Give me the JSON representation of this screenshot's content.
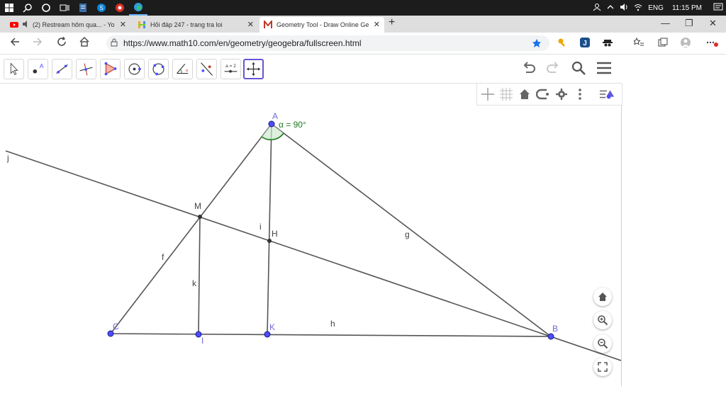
{
  "taskbar": {
    "language": "ENG",
    "time": "11:15 PM"
  },
  "tabs": [
    {
      "label": "(2) Restream hôm qua... - Yo"
    },
    {
      "label": "Hỏi đáp 247 - trang tra loi"
    },
    {
      "label": "Geometry Tool - Draw Online Ge"
    }
  ],
  "address": {
    "url": "https://www.math10.com/en/geometry/geogebra/fullscreen.html"
  },
  "geometry": {
    "points": {
      "A": "A",
      "M": "M",
      "H": "H",
      "C": "C",
      "I": "I",
      "K": "K",
      "B": "B"
    },
    "lines": {
      "j": "j",
      "f": "f",
      "i": "i",
      "g": "g",
      "k": "k",
      "h": "h"
    },
    "angle_label": "α = 90°"
  },
  "toolbar": {
    "input_tool_label": "a = 2"
  },
  "colors": {
    "point_blue": "#4d4dff",
    "point_dark": "#333333",
    "label_blue": "#6b6bd6",
    "angle_green": "#1e7a1e",
    "selected_tool": "#6557d2"
  }
}
